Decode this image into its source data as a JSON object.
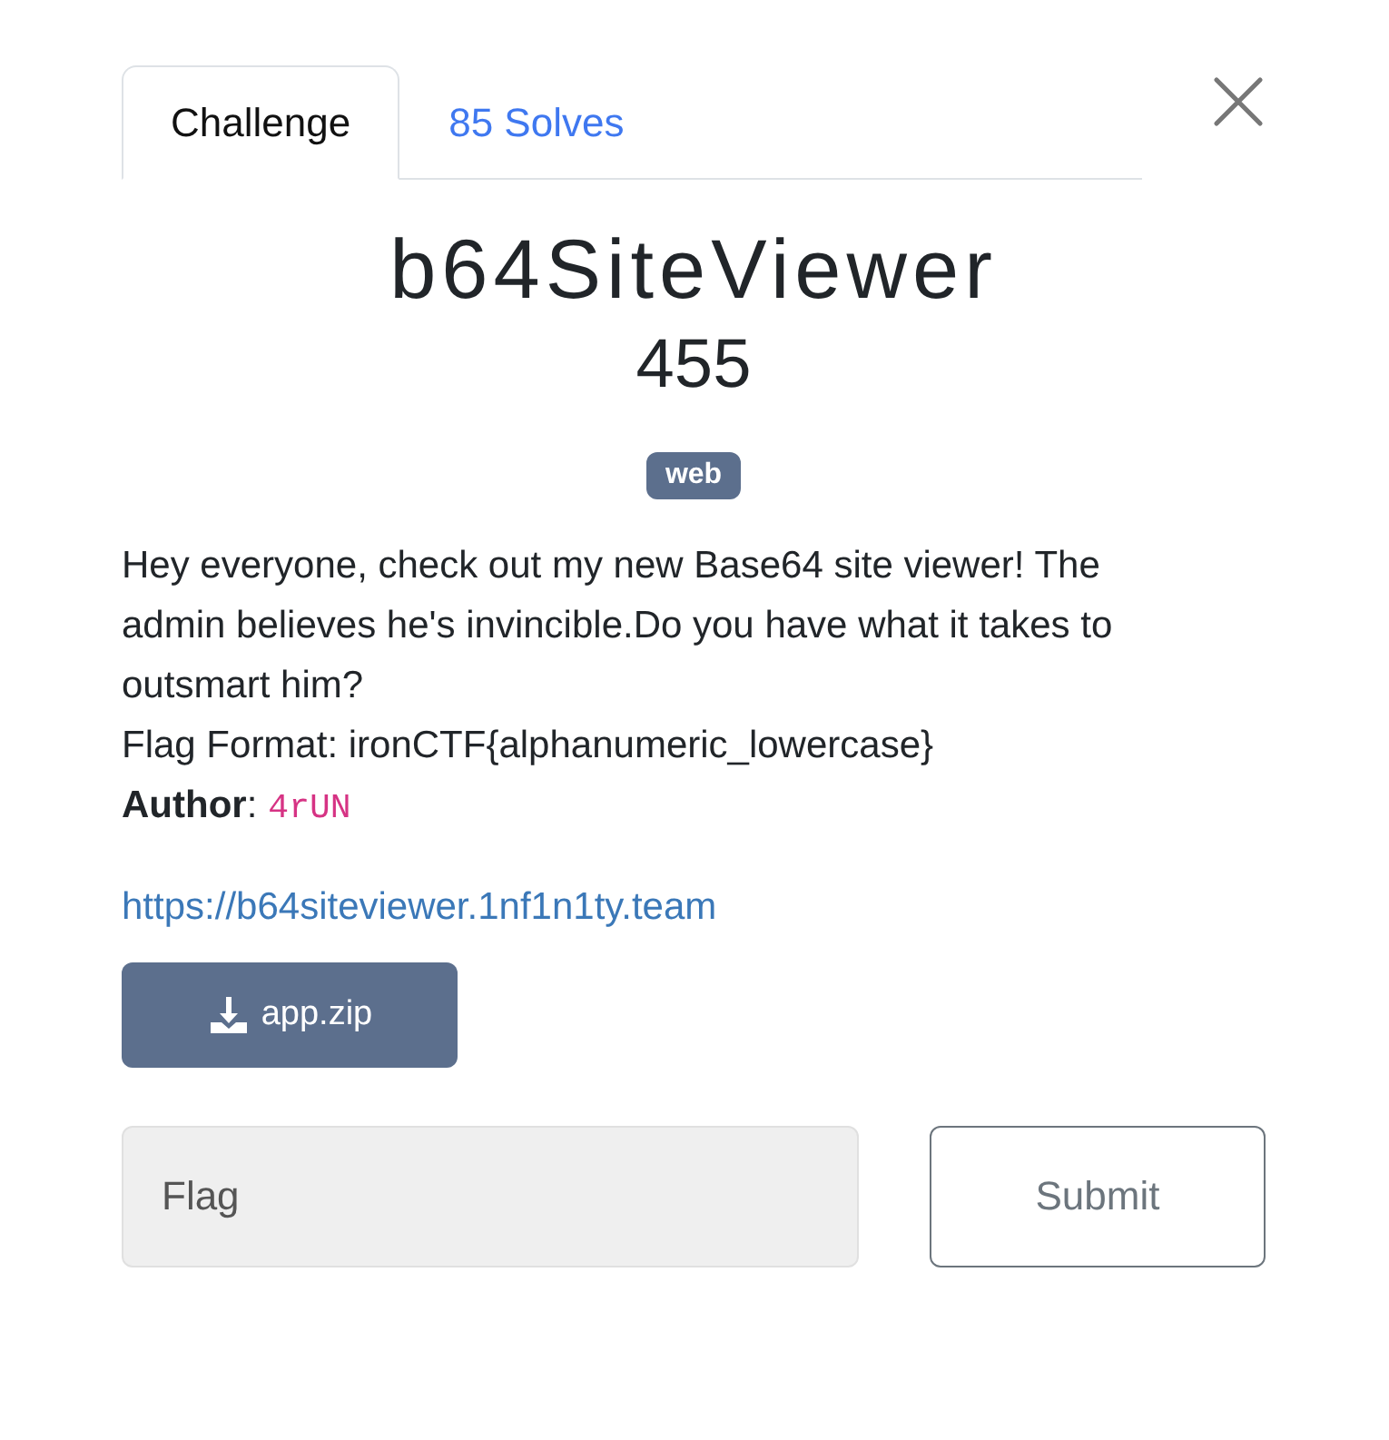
{
  "tabs": [
    {
      "label": "Challenge",
      "selected": true
    },
    {
      "label": "85 Solves",
      "selected": false
    }
  ],
  "challenge": {
    "name": "b64SiteViewer",
    "points": "455",
    "tags": [
      "web"
    ],
    "description": "Hey everyone, check out my new Base64 site viewer! The admin believes he's invincible.Do you have what it takes to outsmart him?",
    "flag_format": "Flag Format: ironCTF{alphanumeric_lowercase}",
    "author_label": "**Author**:",
    "author": "4rUN",
    "link": "https://b64siteviewer.1nf1n1ty.team",
    "files": [
      {
        "name": "app.zip"
      }
    ]
  },
  "flag_input": {
    "placeholder": "Flag"
  },
  "submit": "Submit"
}
